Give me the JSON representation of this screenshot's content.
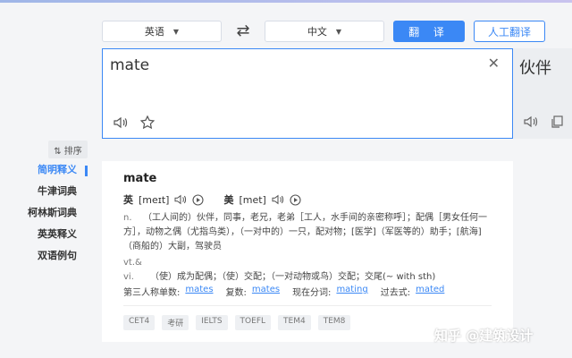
{
  "toolbar": {
    "source_language": "英语",
    "target_language": "中文",
    "swap_icon": "swap-arrows-icon",
    "translate_label": "翻 译",
    "human_translate_label": "人工翻译"
  },
  "input": {
    "text": "mate",
    "clear_icon": "close-icon",
    "tools": [
      "speaker-icon",
      "star-icon"
    ]
  },
  "output": {
    "text": "伙伴",
    "tools": [
      "speaker-icon",
      "copy-icon"
    ]
  },
  "sidebar": {
    "sort_label": "⇅ 排序",
    "items": [
      {
        "label": "简明释义",
        "active": true
      },
      {
        "label": "牛津词典",
        "active": false
      },
      {
        "label": "柯林斯词典",
        "active": false
      },
      {
        "label": "英英释义",
        "active": false
      },
      {
        "label": "双语例句",
        "active": false
      }
    ]
  },
  "entry": {
    "word": "mate",
    "uk_tag": "英",
    "uk_ipa": "[meɪt]",
    "us_tag": "美",
    "us_ipa": "[met]",
    "definitions": [
      {
        "pos": "n.",
        "text": "（工人间的）伙伴，同事，老兄，老弟［工人，水手间的亲密称呼］；配偶［男女任何一方］，动物之偶（尤指鸟类），（一对中的）一只，配对物；[医学]（军医等的）助手；[航海]（商船的）大副，驾驶员"
      },
      {
        "pos": "vt.& vi.",
        "text": "（使）成为配偶；（使）交配；（一对动物或鸟）交配；交尾(~ with sth)"
      }
    ],
    "forms": [
      {
        "label": "第三人称单数:",
        "value": "mates"
      },
      {
        "label": "复数:",
        "value": "mates"
      },
      {
        "label": "现在分词:",
        "value": "mating"
      },
      {
        "label": "过去式:",
        "value": "mated"
      }
    ],
    "tags": [
      "CET4",
      "考研",
      "IELTS",
      "TOEFL",
      "TEM4",
      "TEM8"
    ]
  },
  "watermark": "知乎 @建筑设计",
  "colors": {
    "accent": "#3b88f5",
    "background": "#f4f5f7"
  }
}
